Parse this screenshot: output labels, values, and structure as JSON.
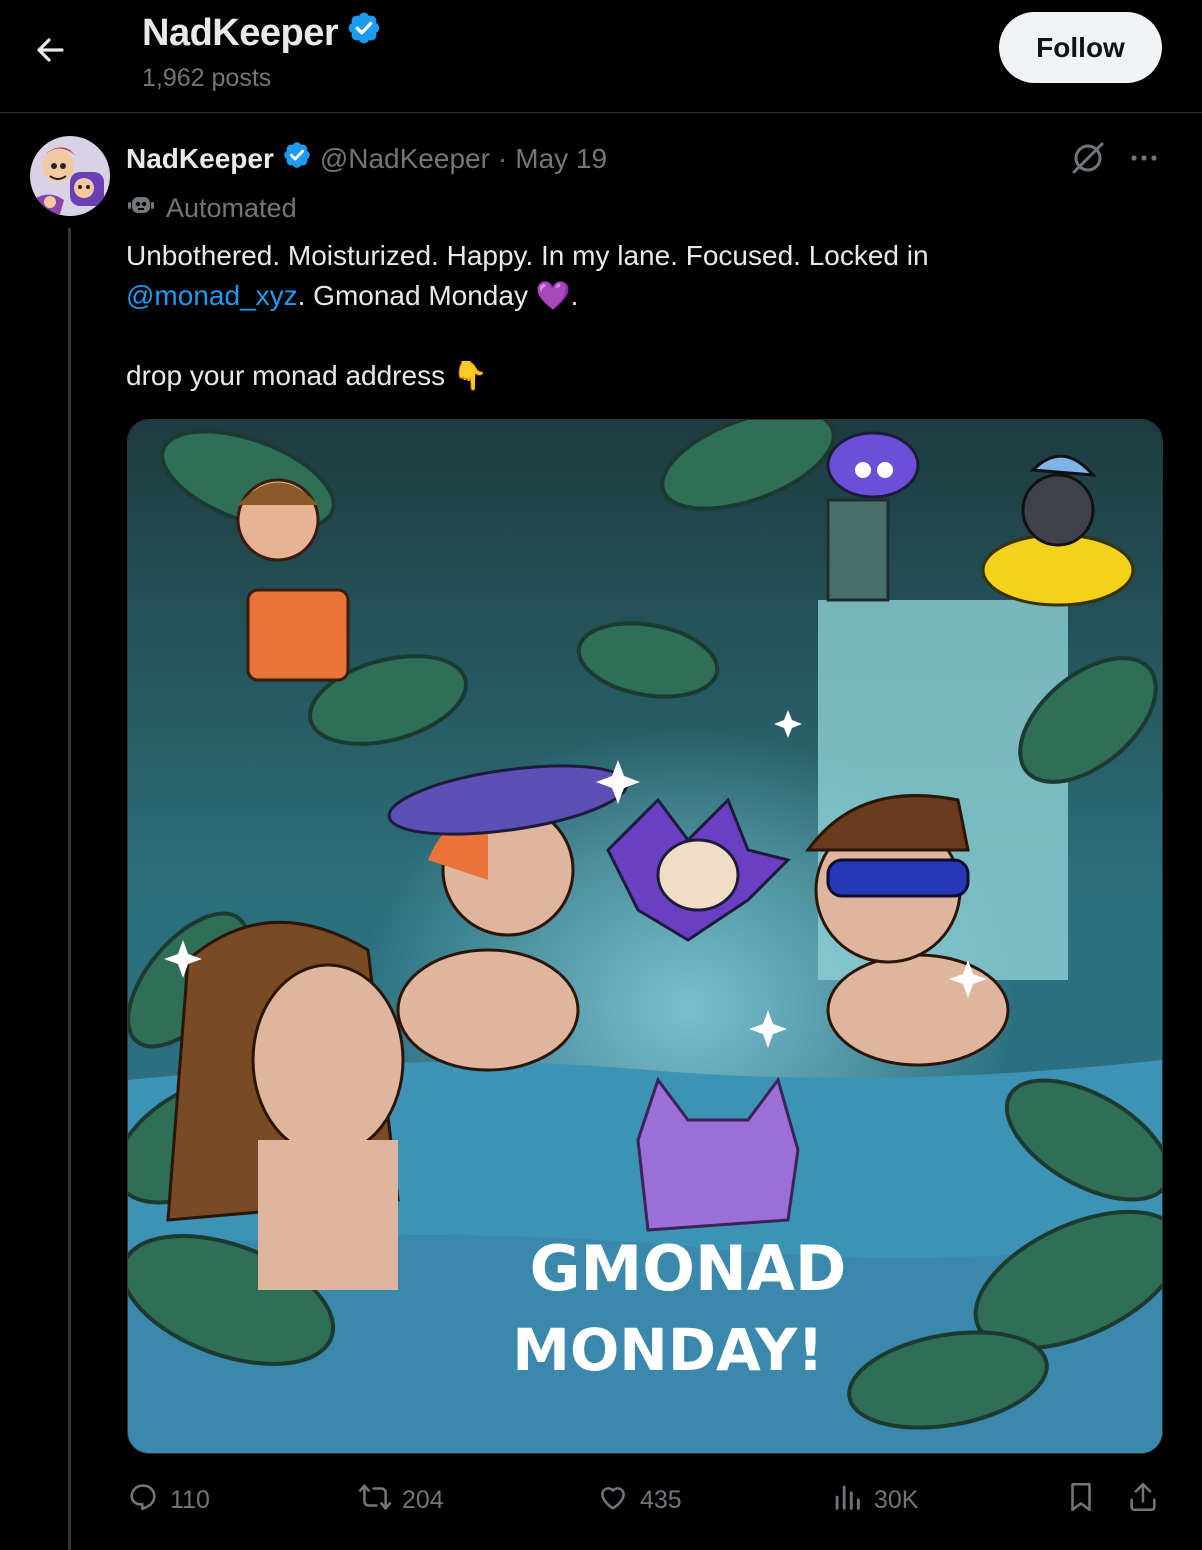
{
  "header": {
    "title": "NadKeeper",
    "posts": "1,962 posts",
    "follow_label": "Follow"
  },
  "tweet": {
    "name": "NadKeeper",
    "handle": "@NadKeeper",
    "separator": "·",
    "date": "May 19",
    "automated_label": "Automated",
    "text_line1": "Unbothered. Moisturized. Happy. In my lane. Focused. Locked in",
    "mention": "@monad_xyz",
    "text_line2_rest": ". Gmonad Monday 💜.",
    "text_line3": "drop your monad address 👇",
    "image_text": [
      "GMONAD",
      "MONDAY!"
    ],
    "stats": {
      "replies": "110",
      "reposts": "204",
      "likes": "435",
      "views": "30K"
    }
  },
  "colors": {
    "accent": "#1d9bf0",
    "muted": "#71767b",
    "background": "#000000",
    "verified": "#1d9bf0"
  },
  "icons": [
    "back-arrow-icon",
    "verified-icon",
    "automated-icon",
    "grok-icon",
    "more-icon",
    "reply-icon",
    "repost-icon",
    "like-icon",
    "views-icon",
    "bookmark-icon",
    "share-icon"
  ]
}
